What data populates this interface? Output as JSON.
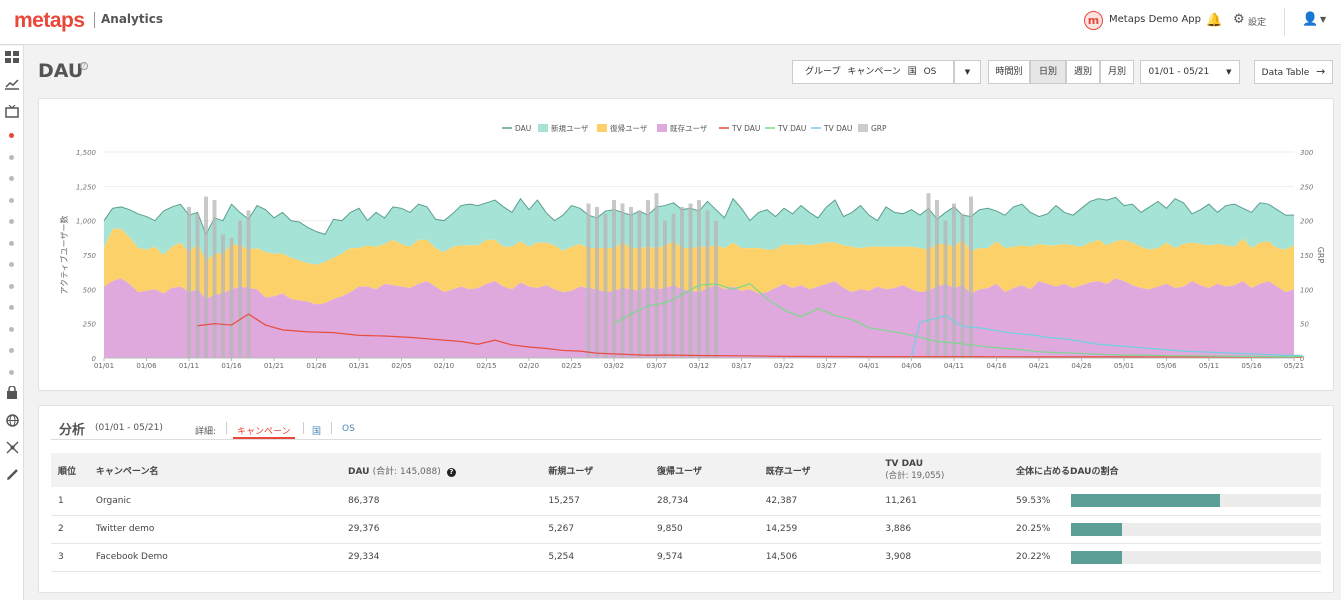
{
  "header": {
    "logo": "metaps",
    "product": "Analytics",
    "app_badge": "m",
    "app_name": "Metaps Demo App",
    "settings_label": "設定",
    "icons": [
      "bell-icon",
      "gear-icon",
      "user-icon",
      "caret-down-icon"
    ]
  },
  "sidebar": {
    "icons": [
      "dashboard-icon",
      "chart-icon",
      "tv-icon",
      "lock-icon",
      "globe-icon",
      "network-icon",
      "pencil-icon"
    ],
    "dot_count": 12,
    "active_dot": 0
  },
  "page": {
    "title": "DAU",
    "help": "?"
  },
  "toolbar": {
    "group_label": "グループ キャンペーン 国 OS",
    "granularity": [
      {
        "label": "時間別",
        "active": false
      },
      {
        "label": "日別",
        "active": true
      },
      {
        "label": "週別",
        "active": false
      },
      {
        "label": "月別",
        "active": false
      }
    ],
    "date_range": "01/01 - 05/21",
    "data_table": "Data Table"
  },
  "chart_data": {
    "type": "area",
    "legend": [
      {
        "name": "DAU",
        "color": "#5b9e8e",
        "shape": "line"
      },
      {
        "name": "新規ユーザ",
        "color": "#a6e3d7",
        "shape": "box"
      },
      {
        "name": "復帰ユーザ",
        "color": "#fdd16a",
        "shape": "box"
      },
      {
        "name": "既存ユーザ",
        "color": "#dfa9dd",
        "shape": "box"
      },
      {
        "name": "TV DAU",
        "color": "#e74c3c",
        "shape": "line"
      },
      {
        "name": "TV DAU",
        "color": "#7bd88f",
        "shape": "line"
      },
      {
        "name": "TV DAU",
        "color": "#6fd0e0",
        "shape": "line"
      },
      {
        "name": "GRP",
        "color": "#cccccc",
        "shape": "box"
      }
    ],
    "ylabel": "アクティブユーザー数",
    "y2label": "GRP",
    "ylim": [
      0,
      1500
    ],
    "y2lim": [
      0,
      300
    ],
    "yticks": [
      "0",
      "250",
      "500",
      "750",
      "1,000",
      "1,250",
      "1,500"
    ],
    "y2ticks": [
      "0",
      "50",
      "100",
      "150",
      "200",
      "250",
      "300"
    ],
    "xticks": [
      "01/01",
      "01/06",
      "01/11",
      "01/16",
      "01/21",
      "01/26",
      "01/31",
      "02/05",
      "02/10",
      "02/15",
      "02/20",
      "02/25",
      "03/02",
      "03/07",
      "03/12",
      "03/17",
      "03/22",
      "03/27",
      "04/01",
      "04/06",
      "04/11",
      "04/16",
      "04/21",
      "04/26",
      "05/01",
      "05/06",
      "05/11",
      "05/16",
      "05/21"
    ],
    "n_days": 141,
    "series_dau": [
      1000,
      1090,
      1100,
      1080,
      1050,
      1030,
      1000,
      1070,
      1100,
      1120,
      1040,
      1060,
      900,
      1020,
      1000,
      1120,
      1060,
      1010,
      1110,
      1080,
      1020,
      1060,
      1000,
      990,
      950,
      920,
      900,
      1010,
      1000,
      1060,
      1090,
      1000,
      1060,
      1020,
      1100,
      1090,
      1060,
      1120,
      1100,
      1010,
      1000,
      1050,
      1110,
      1120,
      1110,
      1130,
      1150,
      1100,
      1060,
      1160,
      1080,
      1150,
      1060,
      1000,
      1040,
      1110,
      1090,
      1040,
      1020,
      1070,
      1080,
      1060,
      1040,
      1070,
      1040,
      1100,
      1110,
      1130,
      1080,
      1090,
      1070,
      1140,
      1080,
      1020,
      1160,
      1090,
      1000,
      1060,
      1080,
      1030,
      1090,
      1050,
      1110,
      1060,
      1020,
      1100,
      1150,
      1030,
      1060,
      1110,
      1040,
      1000,
      1100,
      1060,
      1050,
      1080,
      1040,
      1090,
      1010,
      1060,
      1100,
      1040,
      1030,
      1080,
      1090,
      1070,
      1040,
      1100,
      1120,
      1060,
      1030,
      1050,
      1110,
      1060,
      1040,
      1090,
      1140,
      1160,
      1150,
      1170,
      1110,
      1120,
      1060,
      1100,
      1140,
      1090,
      1160,
      1130,
      1050,
      1080,
      1120,
      1060,
      1110,
      1120,
      1090,
      1060,
      1130,
      1120,
      1080,
      1040,
      1040
    ],
    "series_existing": [
      520,
      560,
      580,
      540,
      480,
      490,
      500,
      470,
      510,
      520,
      480,
      500,
      430,
      460,
      470,
      500,
      520,
      510,
      500,
      440,
      450,
      470,
      430,
      420,
      410,
      390,
      400,
      430,
      450,
      480,
      520,
      520,
      500,
      540,
      530,
      520,
      510,
      540,
      560,
      520,
      480,
      500,
      520,
      500,
      510,
      540,
      560,
      520,
      500,
      550,
      520,
      510,
      530,
      500,
      480,
      490,
      520,
      510,
      500,
      480,
      490,
      510,
      500,
      490,
      520,
      500,
      510,
      530,
      500,
      490,
      480,
      510,
      530,
      500,
      520,
      490,
      500,
      470,
      480,
      510,
      540,
      510,
      530,
      500,
      520,
      540,
      560,
      510,
      480,
      500,
      490,
      520,
      500,
      510,
      530,
      500,
      480,
      490,
      520,
      540,
      510,
      530,
      470,
      500,
      510,
      540,
      480,
      510,
      530,
      500,
      560,
      540,
      520,
      540,
      510,
      530,
      550,
      560,
      540,
      580,
      560,
      530,
      510,
      500,
      520,
      540,
      510,
      520,
      560,
      530,
      510,
      540,
      520,
      530,
      560,
      510,
      540,
      560,
      520,
      480,
      500
    ],
    "series_returning": [
      280,
      380,
      360,
      340,
      320,
      300,
      310,
      280,
      300,
      320,
      290,
      330,
      280,
      300,
      290,
      330,
      300,
      280,
      300,
      330,
      310,
      290,
      300,
      290,
      280,
      290,
      300,
      300,
      310,
      320,
      280,
      300,
      310,
      290,
      330,
      310,
      300,
      320,
      300,
      280,
      290,
      310,
      300,
      320,
      310,
      320,
      300,
      290,
      310,
      300,
      290,
      330,
      310,
      320,
      300,
      320,
      310,
      290,
      300,
      320,
      310,
      330,
      300,
      310,
      290,
      300,
      310,
      320,
      300,
      310,
      330,
      300,
      290,
      300,
      320,
      310,
      300,
      330,
      310,
      280,
      290,
      310,
      300,
      320,
      310,
      300,
      280,
      310,
      330,
      300,
      320,
      290,
      310,
      300,
      280,
      310,
      320,
      300,
      310,
      290,
      300,
      330,
      310,
      300,
      290,
      310,
      320,
      300,
      290,
      310,
      270,
      280,
      300,
      290,
      310,
      280,
      290,
      300,
      280,
      270,
      300,
      310,
      300,
      290,
      280,
      300,
      290,
      310,
      280,
      300,
      310,
      290,
      300,
      280,
      310,
      290,
      300,
      290,
      280,
      310,
      320
    ],
    "tv_red": [
      [
        11,
        235
      ],
      [
        13,
        250
      ],
      [
        15,
        240
      ],
      [
        17,
        320
      ],
      [
        19,
        240
      ],
      [
        21,
        205
      ],
      [
        24,
        190
      ],
      [
        27,
        185
      ],
      [
        30,
        165
      ],
      [
        33,
        160
      ],
      [
        36,
        150
      ],
      [
        39,
        135
      ],
      [
        42,
        120
      ],
      [
        44,
        100
      ],
      [
        46,
        130
      ],
      [
        48,
        95
      ],
      [
        50,
        80
      ],
      [
        52,
        70
      ],
      [
        54,
        55
      ],
      [
        56,
        50
      ],
      [
        58,
        35
      ],
      [
        60,
        30
      ],
      [
        62,
        25
      ],
      [
        64,
        20
      ],
      [
        66,
        22
      ],
      [
        70,
        18
      ],
      [
        75,
        16
      ],
      [
        80,
        12
      ],
      [
        90,
        10
      ],
      [
        100,
        10
      ],
      [
        110,
        8
      ],
      [
        120,
        8
      ],
      [
        130,
        6
      ],
      [
        141,
        5
      ]
    ],
    "tv_green": [
      [
        60,
        250
      ],
      [
        62,
        320
      ],
      [
        64,
        380
      ],
      [
        66,
        400
      ],
      [
        68,
        460
      ],
      [
        70,
        530
      ],
      [
        72,
        540
      ],
      [
        74,
        500
      ],
      [
        76,
        540
      ],
      [
        78,
        430
      ],
      [
        80,
        350
      ],
      [
        82,
        300
      ],
      [
        84,
        360
      ],
      [
        86,
        310
      ],
      [
        88,
        280
      ],
      [
        90,
        220
      ],
      [
        92,
        200
      ],
      [
        94,
        180
      ],
      [
        96,
        150
      ],
      [
        98,
        120
      ],
      [
        100,
        110
      ],
      [
        102,
        95
      ],
      [
        104,
        80
      ],
      [
        106,
        70
      ],
      [
        108,
        60
      ],
      [
        110,
        45
      ],
      [
        112,
        40
      ],
      [
        114,
        35
      ],
      [
        116,
        30
      ],
      [
        118,
        25
      ],
      [
        120,
        22
      ],
      [
        122,
        20
      ],
      [
        124,
        18
      ],
      [
        126,
        16
      ],
      [
        128,
        15
      ],
      [
        130,
        14
      ],
      [
        132,
        13
      ],
      [
        134,
        12
      ],
      [
        136,
        11
      ],
      [
        138,
        10
      ],
      [
        141,
        10
      ]
    ],
    "tv_blue": [
      [
        95,
        10
      ],
      [
        96,
        260
      ],
      [
        98,
        290
      ],
      [
        99,
        310
      ],
      [
        101,
        230
      ],
      [
        103,
        220
      ],
      [
        105,
        200
      ],
      [
        107,
        180
      ],
      [
        109,
        170
      ],
      [
        111,
        150
      ],
      [
        113,
        140
      ],
      [
        115,
        120
      ],
      [
        117,
        100
      ],
      [
        119,
        90
      ],
      [
        121,
        80
      ],
      [
        123,
        70
      ],
      [
        125,
        60
      ],
      [
        127,
        50
      ],
      [
        129,
        45
      ],
      [
        131,
        40
      ],
      [
        133,
        35
      ],
      [
        135,
        30
      ],
      [
        137,
        25
      ],
      [
        139,
        20
      ],
      [
        141,
        18
      ]
    ],
    "grp_bars": [
      [
        10,
        220
      ],
      [
        11,
        210
      ],
      [
        12,
        235
      ],
      [
        13,
        230
      ],
      [
        14,
        180
      ],
      [
        15,
        175
      ],
      [
        16,
        200
      ],
      [
        17,
        215
      ],
      [
        57,
        225
      ],
      [
        58,
        220
      ],
      [
        59,
        210
      ],
      [
        60,
        230
      ],
      [
        61,
        225
      ],
      [
        62,
        220
      ],
      [
        63,
        215
      ],
      [
        64,
        230
      ],
      [
        65,
        240
      ],
      [
        66,
        200
      ],
      [
        67,
        210
      ],
      [
        68,
        220
      ],
      [
        69,
        225
      ],
      [
        70,
        230
      ],
      [
        71,
        215
      ],
      [
        72,
        200
      ],
      [
        97,
        240
      ],
      [
        98,
        230
      ],
      [
        99,
        200
      ],
      [
        100,
        225
      ],
      [
        101,
        210
      ],
      [
        102,
        235
      ]
    ]
  },
  "analysis": {
    "title": "分析",
    "range": "(01/01 - 05/21)",
    "detail_label": "詳細:",
    "tabs": [
      {
        "label": "キャンペーン",
        "active": true
      },
      {
        "label": "国",
        "active": false
      },
      {
        "label": "OS",
        "active": false
      }
    ],
    "columns": {
      "rank": "順位",
      "name": "キャンペーン名",
      "dau": "DAU",
      "dau_total": "(合計: 145,088)",
      "new": "新規ユーザ",
      "returning": "復帰ユーザ",
      "existing": "既存ユーザ",
      "tv": "TV DAU",
      "tv_total": "(合計: 19,055)",
      "share": "全体に占めるDAUの割合"
    },
    "rows": [
      {
        "rank": "1",
        "name": "Organic",
        "dau": "86,378",
        "new": "15,257",
        "returning": "28,734",
        "existing": "42,387",
        "tv": "11,261",
        "share": "59.53%",
        "share_value": 0.5953
      },
      {
        "rank": "2",
        "name": "Twitter demo",
        "dau": "29,376",
        "new": "5,267",
        "returning": "9,850",
        "existing": "14,259",
        "tv": "3,886",
        "share": "20.25%",
        "share_value": 0.2025
      },
      {
        "rank": "3",
        "name": "Facebook Demo",
        "dau": "29,334",
        "new": "5,254",
        "returning": "9,574",
        "existing": "14,506",
        "tv": "3,908",
        "share": "20.22%",
        "share_value": 0.2022
      }
    ]
  }
}
